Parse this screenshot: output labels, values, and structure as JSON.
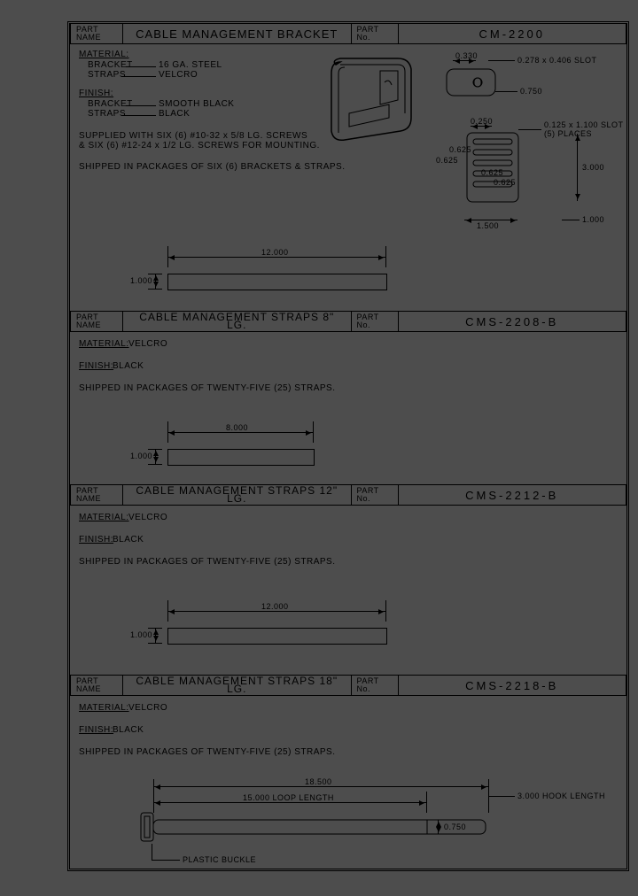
{
  "labels": {
    "partname1": "PART",
    "partname2": "NAME",
    "partno1": "PART",
    "partno2": "No.",
    "material": "MATERIAL:",
    "finish": "FINISH:",
    "bracket": "BRACKET",
    "straps": "STRAPS"
  },
  "s1": {
    "name": "CABLE MANAGEMENT BRACKET",
    "no": "CM-2200",
    "mat_bracket": "16 GA. STEEL",
    "mat_straps": "VELCRO",
    "fin_bracket": "SMOOTH BLACK",
    "fin_straps": "BLACK",
    "supplied1": "SUPPLIED WITH SIX (6) #10-32 x 5/8 LG. SCREWS",
    "supplied2": "& SIX (6) #12-24 x 1/2 LG. SCREWS FOR MOUNTING.",
    "shipped": "SHIPPED IN PACKAGES OF SIX (6) BRACKETS & STRAPS.",
    "strip_len": "12.000",
    "strip_h": "1.000",
    "d_0330": "0.330",
    "d_slot1": "0.278 x 0.406 SLOT",
    "d_0750": "0.750",
    "d_0250": "0.250",
    "d_slot2": "0.125 x 1.100 SLOT",
    "d_places": "(5) PLACES",
    "d_0625": "0.625",
    "d_3000": "3.000",
    "d_1500": "1.500",
    "d_1000": "1.000"
  },
  "s2": {
    "name": "CABLE MANAGEMENT STRAPS 8\" LG.",
    "no": "CMS-2208-B",
    "material": "VELCRO",
    "finish": "BLACK",
    "shipped": "SHIPPED IN PACKAGES OF TWENTY-FIVE (25) STRAPS.",
    "strip_len": "8.000",
    "strip_h": "1.000"
  },
  "s3": {
    "name": "CABLE MANAGEMENT STRAPS 12\" LG.",
    "no": "CMS-2212-B",
    "material": "VELCRO",
    "finish": "BLACK",
    "shipped": "SHIPPED IN PACKAGES OF TWENTY-FIVE (25) STRAPS.",
    "strip_len": "12.000",
    "strip_h": "1.000"
  },
  "s4": {
    "name": "CABLE MANAGEMENT STRAPS 18\" LG.",
    "no": "CMS-2218-B",
    "material": "VELCRO",
    "finish": "BLACK",
    "shipped": "SHIPPED IN PACKAGES OF TWENTY-FIVE (25) STRAPS.",
    "d_18500": "18.500",
    "d_loop": "15.000 LOOP LENGTH",
    "d_hook": "3.000 HOOK LENGTH",
    "d_0750": "0.750",
    "d_buckle": "PLASTIC BUCKLE"
  }
}
